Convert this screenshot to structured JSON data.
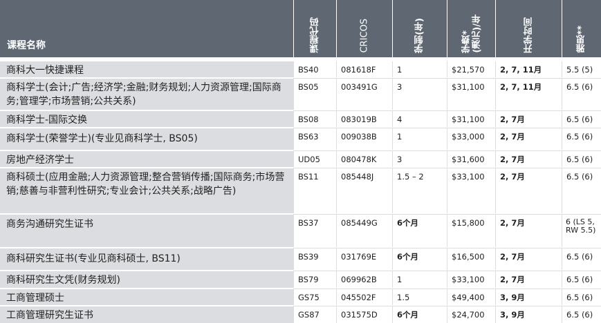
{
  "header": {
    "name": "课程名称",
    "code": "课程代码",
    "cricos": "CRICOS",
    "duration": "学制(年)",
    "fee_line1": "学费*",
    "fee_line2": "(澳元)/年",
    "intake": "开学时间",
    "ielts": "雅思**"
  },
  "rows": [
    {
      "name": "商科大一快捷课程",
      "code": "BS40",
      "cricos": "081618F",
      "duration": "1",
      "fee": "$21,570",
      "intake": "2, 7, 11月",
      "ielts": "5.5 (5)"
    },
    {
      "name": "商科学士(会计;广告;经济学;金融;财务规划;人力资源管理;国际商务;管理学;市场营销;公共关系)",
      "code": "BS05",
      "cricos": "003491G",
      "duration": "3",
      "fee": "$31,100",
      "intake": "2, 7, 11月",
      "ielts": "6.5 (6)"
    },
    {
      "name": "商科学士-国际交换",
      "code": "BS08",
      "cricos": "083019B",
      "duration": "4",
      "fee": "$31,100",
      "intake": "2, 7月",
      "ielts": "6.5 (6)"
    },
    {
      "name": "商科学士(荣誉学士)(专业见商科学士, BS05)",
      "code": "BS63",
      "cricos": "009038B",
      "duration": "1",
      "fee": "$33,000",
      "intake": "2, 7月",
      "ielts": "6.5 (6)"
    },
    {
      "name": "房地产经济学士",
      "code": "UD05",
      "cricos": "080478K",
      "duration": "3",
      "fee": "$31,600",
      "intake": "2, 7月",
      "ielts": "6.5 (6)"
    },
    {
      "name": "商科硕士(应用金融;人力资源管理;整合营销传播;国际商务;市场营销;慈善与非营利性研究;专业会计;公共关系;战略广告)",
      "code": "BS11",
      "cricos": "085448J",
      "duration": "1.5 – 2",
      "fee": "$33,100",
      "intake": "2, 7月",
      "ielts": "6.5 (6)"
    },
    {
      "name": "商务沟通研究生证书",
      "code": "BS37",
      "cricos": "085449G",
      "duration": "6个月",
      "fee": "$15,800",
      "intake": "2, 7月",
      "ielts": "6 (LS 5, RW 5.5)"
    },
    {
      "name": "商科研究生证书(专业见商科硕士, BS11)",
      "code": "BS39",
      "cricos": "031769E",
      "duration": "6个月",
      "fee": "$16,500",
      "intake": "2, 7月",
      "ielts": "6.5 (6)"
    },
    {
      "name": "商科研究生文凭(财务规划)",
      "code": "BS79",
      "cricos": "069962B",
      "duration": "1",
      "fee": "$33,100",
      "intake": "2, 7月",
      "ielts": "6.5 (6)"
    },
    {
      "name": "工商管理硕士",
      "code": "GS75",
      "cricos": "045502F",
      "duration": "1.5",
      "fee": "$49,400",
      "intake": "3, 9月",
      "ielts": "6.5 (6)"
    },
    {
      "name": "工商管理研究生证书",
      "code": "GS87",
      "cricos": "031575D",
      "duration": "6个月",
      "fee": "$24,700",
      "intake": "3, 9月",
      "ielts": "6.5 (6)"
    }
  ]
}
